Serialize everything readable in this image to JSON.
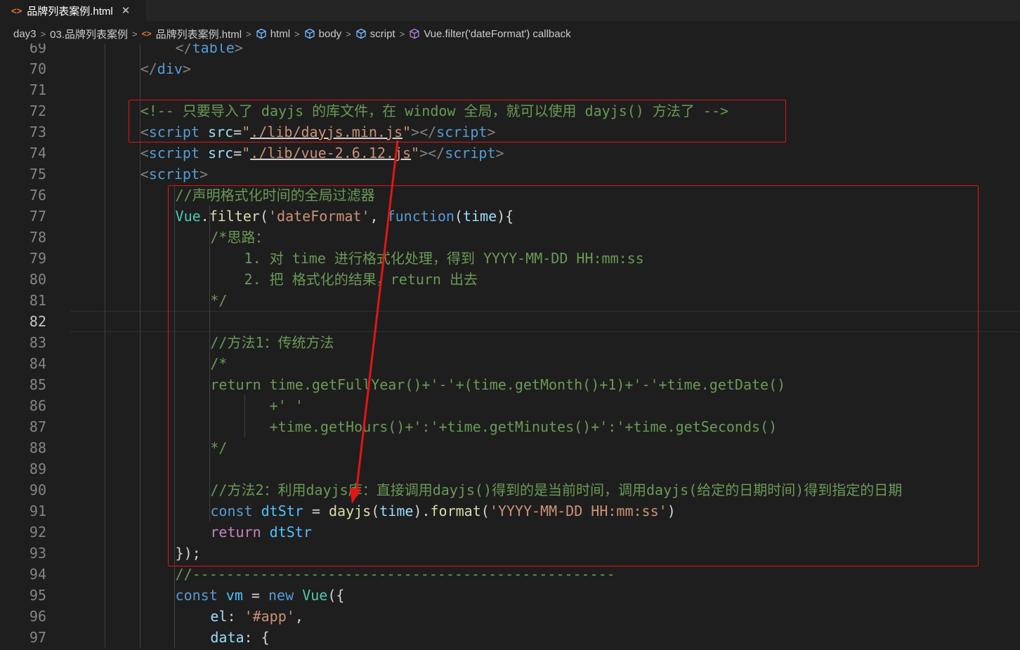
{
  "tab": {
    "icon": "<>",
    "title": "品牌列表案例.html",
    "close": "✕"
  },
  "breadcrumb": {
    "items": [
      {
        "label": "day3"
      },
      {
        "label": "03.品牌列表案例"
      },
      {
        "label": "品牌列表案例.html",
        "icon": "html-file-icon"
      },
      {
        "label": "html",
        "icon": "element-cube-icon"
      },
      {
        "label": "body",
        "icon": "element-cube-icon"
      },
      {
        "label": "script",
        "icon": "element-cube-icon"
      },
      {
        "label": "Vue.filter('dateFormat') callback",
        "icon": "method-cube-icon"
      }
    ],
    "separator": ">"
  },
  "editor": {
    "active_line": "82",
    "lines": [
      {
        "n": "69",
        "indent": 6,
        "t": [
          [
            "br",
            "</"
          ],
          [
            "tag",
            "table"
          ],
          [
            "br",
            ">"
          ]
        ]
      },
      {
        "n": "70",
        "indent": 4,
        "t": [
          [
            "br",
            "</"
          ],
          [
            "tag",
            "div"
          ],
          [
            "br",
            ">"
          ]
        ]
      },
      {
        "n": "71",
        "indent": 0,
        "t": []
      },
      {
        "n": "72",
        "indent": 4,
        "t": [
          [
            "cm",
            "<!-- 只要导入了 dayjs 的库文件，在 window 全局，就可以使用 dayjs() 方法了 -->"
          ]
        ]
      },
      {
        "n": "73",
        "indent": 4,
        "t": [
          [
            "br",
            "<"
          ],
          [
            "tag",
            "script"
          ],
          [
            "p",
            " "
          ],
          [
            "attr",
            "src"
          ],
          [
            "p",
            "="
          ],
          [
            "str",
            "\""
          ],
          [
            "strul",
            "./lib/dayjs.min.js"
          ],
          [
            "str",
            "\""
          ],
          [
            "br",
            "></"
          ],
          [
            "tag",
            "script"
          ],
          [
            "br",
            ">"
          ]
        ]
      },
      {
        "n": "74",
        "indent": 4,
        "t": [
          [
            "br",
            "<"
          ],
          [
            "tag",
            "script"
          ],
          [
            "p",
            " "
          ],
          [
            "attr",
            "src"
          ],
          [
            "p",
            "="
          ],
          [
            "str",
            "\""
          ],
          [
            "strul",
            "./lib/vue-2.6.12.js"
          ],
          [
            "str",
            "\""
          ],
          [
            "br",
            "></"
          ],
          [
            "tag",
            "script"
          ],
          [
            "br",
            ">"
          ]
        ]
      },
      {
        "n": "75",
        "indent": 4,
        "t": [
          [
            "br",
            "<"
          ],
          [
            "tag",
            "script"
          ],
          [
            "br",
            ">"
          ]
        ]
      },
      {
        "n": "76",
        "indent": 6,
        "t": [
          [
            "cm",
            "//声明格式化时间的全局过滤器"
          ]
        ]
      },
      {
        "n": "77",
        "indent": 6,
        "t": [
          [
            "type",
            "Vue"
          ],
          [
            "p",
            "."
          ],
          [
            "fn",
            "filter"
          ],
          [
            "p",
            "("
          ],
          [
            "str",
            "'dateFormat'"
          ],
          [
            "p",
            ", "
          ],
          [
            "kw",
            "function"
          ],
          [
            "p",
            "("
          ],
          [
            "var",
            "time"
          ],
          [
            "p",
            "){"
          ]
        ]
      },
      {
        "n": "78",
        "indent": 8,
        "t": [
          [
            "cm",
            "/*思路："
          ]
        ]
      },
      {
        "n": "79",
        "indent": 8,
        "t": [
          [
            "cm",
            "    1. 对 time 进行格式化处理，得到 YYYY-MM-DD HH:mm:ss"
          ]
        ]
      },
      {
        "n": "80",
        "indent": 8,
        "t": [
          [
            "cm",
            "    2. 把 格式化的结果，return 出去"
          ]
        ]
      },
      {
        "n": "81",
        "indent": 8,
        "t": [
          [
            "cm",
            "*/"
          ]
        ]
      },
      {
        "n": "82",
        "indent": 0,
        "t": []
      },
      {
        "n": "83",
        "indent": 8,
        "t": [
          [
            "cm",
            "//方法1：传统方法"
          ]
        ]
      },
      {
        "n": "84",
        "indent": 8,
        "t": [
          [
            "cm",
            "/*"
          ]
        ]
      },
      {
        "n": "85",
        "indent": 8,
        "t": [
          [
            "cm",
            "return time.getFullYear()+'-'+(time.getMonth()+1)+'-'+time.getDate()"
          ]
        ]
      },
      {
        "n": "86",
        "indent": 8,
        "t": [
          [
            "cm",
            "       +' '"
          ]
        ]
      },
      {
        "n": "87",
        "indent": 8,
        "t": [
          [
            "cm",
            "       +time.getHours()+':'+time.getMinutes()+':'+time.getSeconds()"
          ]
        ]
      },
      {
        "n": "88",
        "indent": 8,
        "t": [
          [
            "cm",
            "*/"
          ]
        ]
      },
      {
        "n": "89",
        "indent": 0,
        "t": []
      },
      {
        "n": "90",
        "indent": 8,
        "t": [
          [
            "cm",
            "//方法2：利用dayjs库：直接调用dayjs()得到的是当前时间，调用dayjs(给定的日期时间)得到指定的日期"
          ]
        ]
      },
      {
        "n": "91",
        "indent": 8,
        "t": [
          [
            "kw",
            "const"
          ],
          [
            "p",
            " "
          ],
          [
            "const",
            "dtStr"
          ],
          [
            "p",
            " = "
          ],
          [
            "fn",
            "dayjs"
          ],
          [
            "p",
            "("
          ],
          [
            "var",
            "time"
          ],
          [
            "p",
            ")."
          ],
          [
            "fn",
            "format"
          ],
          [
            "p",
            "("
          ],
          [
            "str",
            "'YYYY-MM-DD HH:mm:ss'"
          ],
          [
            "p",
            ")"
          ]
        ]
      },
      {
        "n": "92",
        "indent": 8,
        "t": [
          [
            "kw2",
            "return"
          ],
          [
            "p",
            " "
          ],
          [
            "const",
            "dtStr"
          ]
        ]
      },
      {
        "n": "93",
        "indent": 6,
        "t": [
          [
            "p",
            "});"
          ]
        ]
      },
      {
        "n": "94",
        "indent": 6,
        "t": [
          [
            "cm",
            "//--------------------------------------------------"
          ]
        ]
      },
      {
        "n": "95",
        "indent": 6,
        "t": [
          [
            "kw",
            "const"
          ],
          [
            "p",
            " "
          ],
          [
            "const",
            "vm"
          ],
          [
            "p",
            " = "
          ],
          [
            "kw",
            "new"
          ],
          [
            "p",
            " "
          ],
          [
            "type",
            "Vue"
          ],
          [
            "p",
            "({"
          ]
        ]
      },
      {
        "n": "96",
        "indent": 8,
        "t": [
          [
            "var",
            "el"
          ],
          [
            "p",
            ": "
          ],
          [
            "str",
            "'#app'"
          ],
          [
            "p",
            ","
          ]
        ]
      },
      {
        "n": "97",
        "indent": 8,
        "t": [
          [
            "var",
            "data"
          ],
          [
            "p",
            ": {"
          ]
        ]
      }
    ]
  },
  "colors": {
    "background": "#1e1e1e",
    "annotation_red": "#e51414",
    "comment": "#6a9955",
    "keyword": "#569cd6",
    "string": "#ce9178",
    "function": "#dcdcaa"
  }
}
